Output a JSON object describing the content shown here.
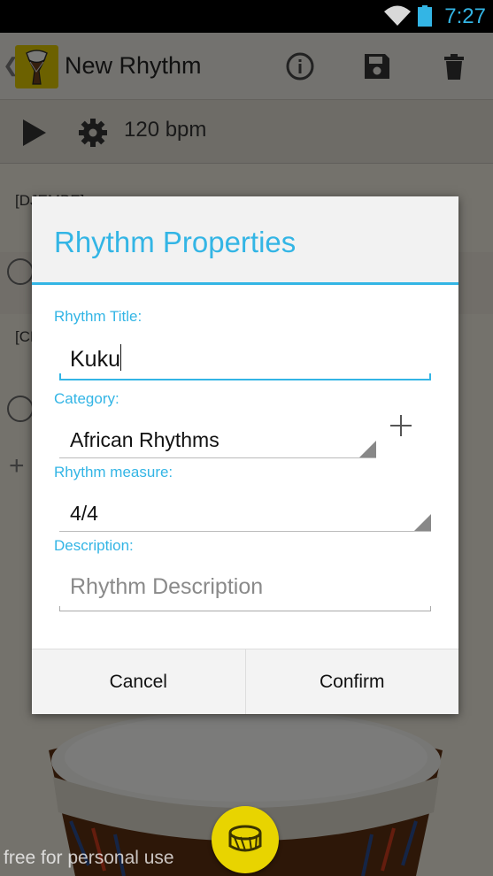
{
  "status_bar": {
    "time": "7:27",
    "icons": [
      "wifi-icon",
      "battery-icon"
    ]
  },
  "action_bar": {
    "title": "New Rhythm",
    "icons": [
      "back-chevron-icon",
      "djembe-app-icon",
      "info-icon",
      "save-icon",
      "delete-icon"
    ]
  },
  "toolbar": {
    "bpm": "120 bpm",
    "icons": [
      "play-icon",
      "gear-icon"
    ]
  },
  "background_list": {
    "track_1_label": "[DJEMBE]",
    "track_2_label": "[CL"
  },
  "dialog": {
    "title": "Rhythm Properties",
    "title_label": "Rhythm Title:",
    "title_value": "Kuku",
    "category_label": "Category:",
    "category_value": "African Rhythms",
    "measure_label": "Rhythm measure:",
    "measure_value": "4/4",
    "description_label": "Description:",
    "description_placeholder": "Rhythm Description",
    "cancel_label": "Cancel",
    "confirm_label": "Confirm"
  },
  "watermark": "free for personal use",
  "colors": {
    "accent": "#33b5e5",
    "fab": "#e8d400"
  }
}
